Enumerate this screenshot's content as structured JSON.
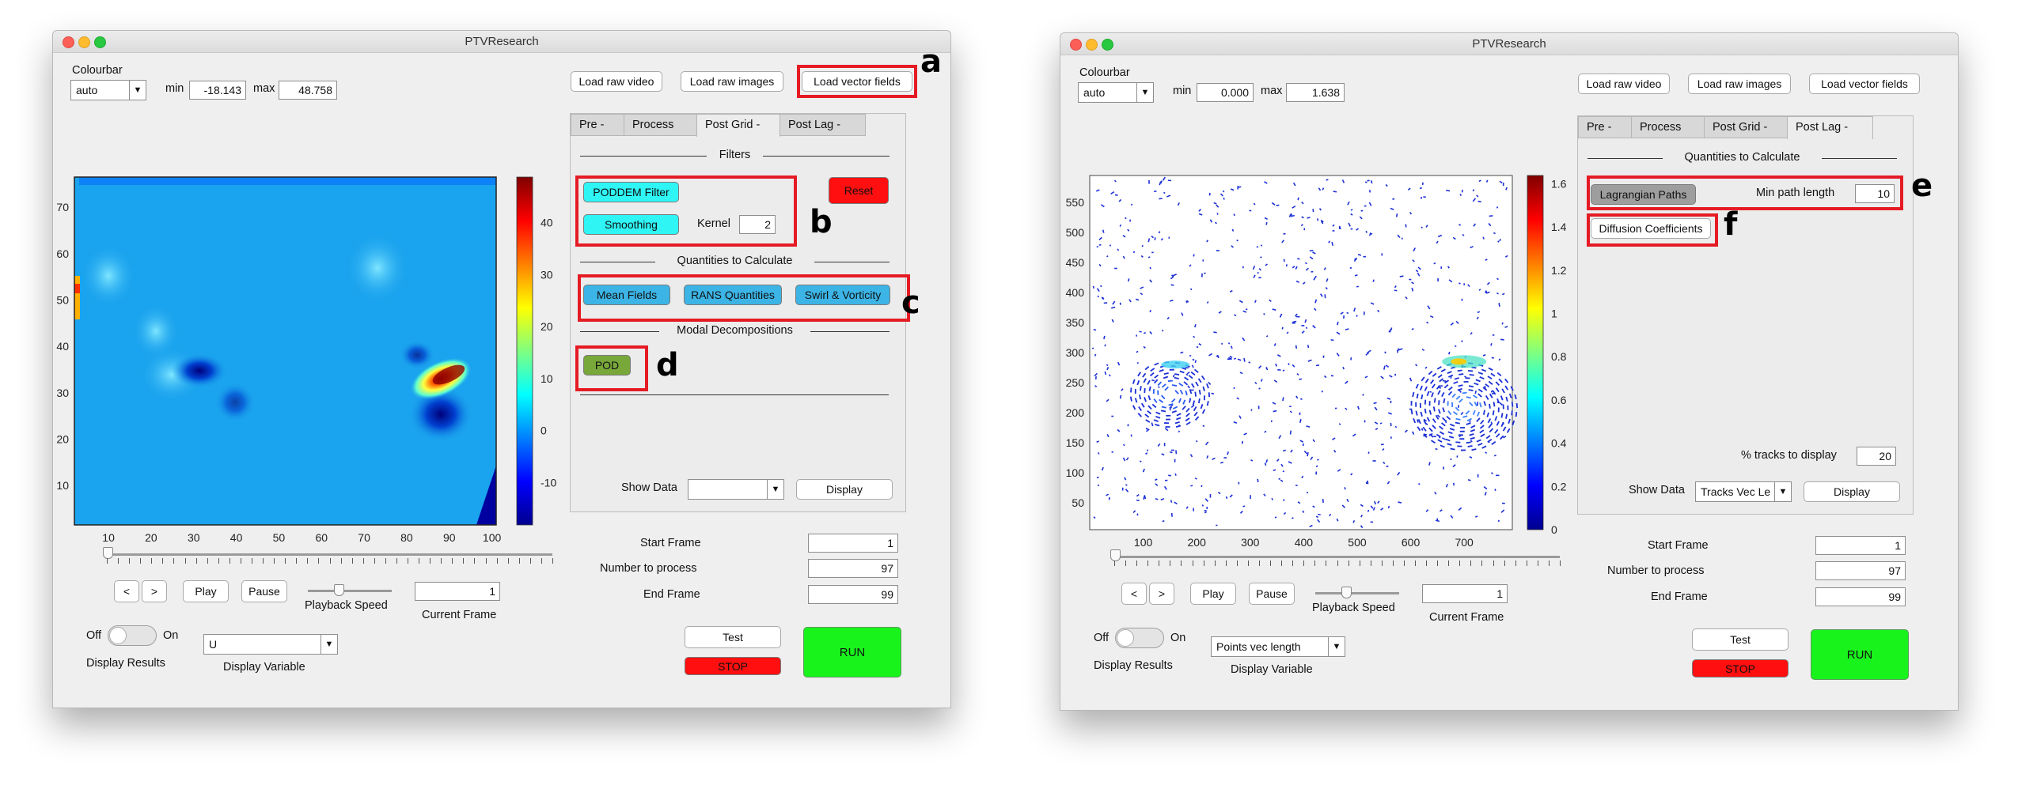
{
  "app_title": "PTVResearch",
  "labels": {
    "colourbar": "Colourbar",
    "min": "min",
    "max": "max",
    "show_data": "Show Data",
    "start_frame": "Start Frame",
    "number_to_process": "Number to process",
    "end_frame": "End Frame",
    "current_frame": "Current Frame",
    "playback_speed": "Playback Speed",
    "display_results": "Display Results",
    "display_variable": "Display Variable",
    "off": "Off",
    "on": "On"
  },
  "buttons": {
    "load_raw_video": "Load raw video",
    "load_raw_images": "Load raw images",
    "load_vector_fields": "Load vector fields",
    "display": "Display",
    "test": "Test",
    "stop": "STOP",
    "run": "RUN",
    "prev": "<",
    "next": ">",
    "play": "Play",
    "pause": "Pause"
  },
  "tabs": [
    "Pre -",
    "Process",
    "Post Grid -",
    "Post Lag -"
  ],
  "colors": {
    "cyan": "#2ff5f5",
    "blue": "#3cb4e6",
    "olive": "#78a73a",
    "red": "#ff0f0f",
    "green": "#19f31c",
    "annotation_box": "#e51b24"
  },
  "left": {
    "colourbar_mode": "auto",
    "min": "-18.143",
    "max": "48.758",
    "active_tab": "Post Grid -",
    "filters_title": "Filters",
    "poddem_filter": "PODDEM Filter",
    "reset": "Reset",
    "smoothing": "Smoothing",
    "kernel_label": "Kernel",
    "kernel_value": "2",
    "quantities_title": "Quantities to Calculate",
    "mean_fields": "Mean Fields",
    "rans_quantities": "RANS Quantities",
    "swirl_vorticity": "Swirl & Vorticity",
    "modal_title": "Modal Decompositions",
    "pod": "POD",
    "show_data_value": "",
    "start_frame": "1",
    "number_to_process": "97",
    "end_frame": "99",
    "current_frame": "1",
    "display_variable": "U",
    "plot": {
      "x_ticks": [
        "10",
        "20",
        "30",
        "40",
        "50",
        "60",
        "70",
        "80",
        "90",
        "100"
      ],
      "y_ticks": [
        "10",
        "20",
        "30",
        "40",
        "50",
        "60",
        "70"
      ],
      "cbar_ticks": [
        "40",
        "30",
        "20",
        "10",
        "0",
        "-10"
      ]
    }
  },
  "right": {
    "colourbar_mode": "auto",
    "min": "0.000",
    "max": "1.638",
    "active_tab": "Post Lag -",
    "quantities_title": "Quantities to Calculate",
    "lagrangian_paths": "Lagrangian Paths",
    "min_path_label": "Min path length",
    "min_path_value": "10",
    "diffusion_coefficients": "Diffusion Coefficients",
    "tracks_label": "% tracks to display",
    "tracks_value": "20",
    "show_data_value": "Tracks Vec Le",
    "start_frame": "1",
    "number_to_process": "97",
    "end_frame": "99",
    "current_frame": "1",
    "display_variable": "Points vec length",
    "plot": {
      "x_ticks": [
        "100",
        "200",
        "300",
        "400",
        "500",
        "600",
        "700"
      ],
      "y_ticks": [
        "50",
        "100",
        "150",
        "200",
        "250",
        "300",
        "350",
        "400",
        "450",
        "500",
        "550"
      ],
      "cbar_ticks": [
        "1.6",
        "1.4",
        "1.2",
        "1",
        "0.8",
        "0.6",
        "0.4",
        "0.2",
        "0"
      ]
    }
  },
  "annotations": [
    "a",
    "b",
    "c",
    "d",
    "e",
    "f"
  ]
}
